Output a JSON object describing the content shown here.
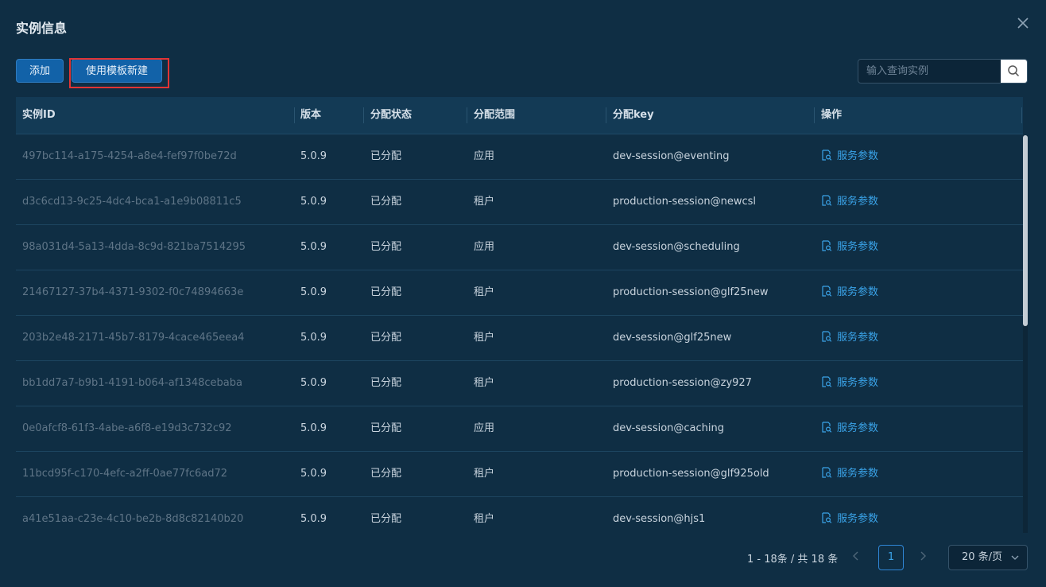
{
  "dialog": {
    "title": "实例信息"
  },
  "toolbar": {
    "add_label": "添加",
    "template_label": "使用模板新建"
  },
  "search": {
    "placeholder": "输入查询实例"
  },
  "table": {
    "columns": [
      "实例ID",
      "版本",
      "分配状态",
      "分配范围",
      "分配key",
      "操作"
    ],
    "rows": [
      {
        "id": "497bc114-a175-4254-a8e4-fef97f0be72d",
        "version": "5.0.9",
        "status": "已分配",
        "scope": "应用",
        "key": "dev-session@eventing",
        "action": "服务参数"
      },
      {
        "id": "d3c6cd13-9c25-4dc4-bca1-a1e9b08811c5",
        "version": "5.0.9",
        "status": "已分配",
        "scope": "租户",
        "key": "production-session@newcsl",
        "action": "服务参数"
      },
      {
        "id": "98a031d4-5a13-4dda-8c9d-821ba7514295",
        "version": "5.0.9",
        "status": "已分配",
        "scope": "应用",
        "key": "dev-session@scheduling",
        "action": "服务参数"
      },
      {
        "id": "21467127-37b4-4371-9302-f0c74894663e",
        "version": "5.0.9",
        "status": "已分配",
        "scope": "租户",
        "key": "production-session@glf25new",
        "action": "服务参数"
      },
      {
        "id": "203b2e48-2171-45b7-8179-4cace465eea4",
        "version": "5.0.9",
        "status": "已分配",
        "scope": "租户",
        "key": "dev-session@glf25new",
        "action": "服务参数"
      },
      {
        "id": "bb1dd7a7-b9b1-4191-b064-af1348cebaba",
        "version": "5.0.9",
        "status": "已分配",
        "scope": "租户",
        "key": "production-session@zy927",
        "action": "服务参数"
      },
      {
        "id": "0e0afcf8-61f3-4abe-a6f8-e19d3c732c92",
        "version": "5.0.9",
        "status": "已分配",
        "scope": "应用",
        "key": "dev-session@caching",
        "action": "服务参数"
      },
      {
        "id": "11bcd95f-c170-4efc-a2ff-0ae77fc6ad72",
        "version": "5.0.9",
        "status": "已分配",
        "scope": "租户",
        "key": "production-session@glf925old",
        "action": "服务参数"
      },
      {
        "id": "a41e51aa-c23e-4c10-be2b-8d8c82140b20",
        "version": "5.0.9",
        "status": "已分配",
        "scope": "租户",
        "key": "dev-session@hjs1",
        "action": "服务参数"
      }
    ]
  },
  "pagination": {
    "total_text": "1 - 18条 / 共 18 条",
    "current_page": "1",
    "page_size": "20 条/页"
  },
  "icons": {
    "close": "close-icon",
    "search": "search-icon",
    "action": "document-search-icon",
    "prev": "chevron-left-icon",
    "next": "chevron-right-icon",
    "dropdown": "chevron-down-icon"
  },
  "colors": {
    "background": "#0f2e44",
    "header": "#133a55",
    "primary": "#1262a8",
    "link": "#3aa3e8",
    "highlight": "#e23434"
  }
}
